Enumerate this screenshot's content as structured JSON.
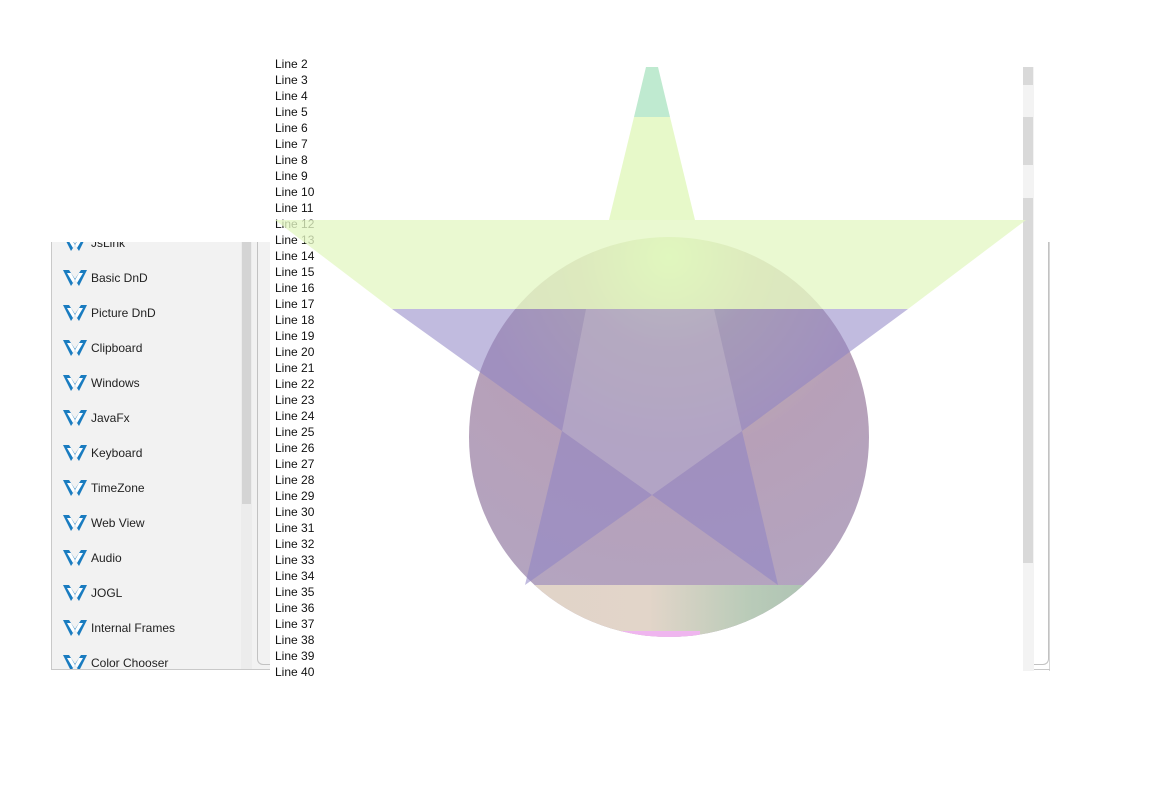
{
  "nav": {
    "items": [
      {
        "label": "JsLink",
        "icon": "dukes-app-icon"
      },
      {
        "label": "Basic DnD",
        "icon": "dukes-app-icon"
      },
      {
        "label": "Picture DnD",
        "icon": "dukes-app-icon"
      },
      {
        "label": "Clipboard",
        "icon": "dukes-app-icon"
      },
      {
        "label": "Windows",
        "icon": "dukes-app-icon"
      },
      {
        "label": "JavaFx",
        "icon": "dukes-app-icon"
      },
      {
        "label": "Keyboard",
        "icon": "dukes-app-icon"
      },
      {
        "label": "TimeZone",
        "icon": "dukes-app-icon"
      },
      {
        "label": "Web View",
        "icon": "dukes-app-icon"
      },
      {
        "label": "Audio",
        "icon": "dukes-app-icon"
      },
      {
        "label": "JOGL",
        "icon": "dukes-app-icon"
      },
      {
        "label": "Internal Frames",
        "icon": "dukes-app-icon"
      },
      {
        "label": "Color Chooser",
        "icon": "dukes-app-icon"
      }
    ]
  },
  "lines": [
    "Line 2",
    "Line 3",
    "Line 4",
    "Line 5",
    "Line 6",
    "Line 7",
    "Line 8",
    "Line 9",
    "Line 10",
    "Line 11",
    "Line 12",
    "Line 13",
    "Line 14",
    "Line 15",
    "Line 16",
    "Line 17",
    "Line 18",
    "Line 19",
    "Line 20",
    "Line 21",
    "Line 22",
    "Line 23",
    "Line 24",
    "Line 25",
    "Line 26",
    "Line 27",
    "Line 28",
    "Line 29",
    "Line 30",
    "Line 31",
    "Line 32",
    "Line 33",
    "Line 34",
    "Line 35",
    "Line 36",
    "Line 37",
    "Line 38",
    "Line 39",
    "Line 40"
  ],
  "colors": {
    "star_top": "#e6f9c6",
    "star_bottom": "#b8b4da",
    "circle_base": "#b8a3b8",
    "star_tip": "#bfead0",
    "accent_icon": "#1a7cc0"
  }
}
